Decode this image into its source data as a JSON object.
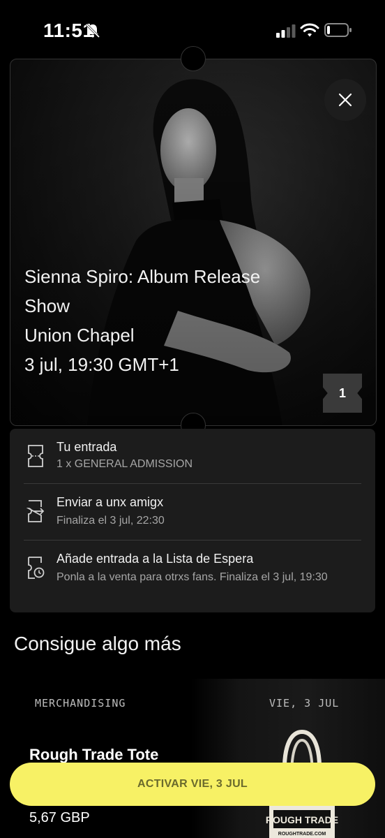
{
  "status_bar": {
    "time": "11:51"
  },
  "event": {
    "title": "Sienna Spiro: Album Release Show",
    "venue": "Union Chapel",
    "date": "3 jul, 19:30 GMT+1",
    "ticket_count": "1"
  },
  "actions": [
    {
      "title": "Tu entrada",
      "subtitle": "1 x GENERAL ADMISSION",
      "icon": "ticket-icon"
    },
    {
      "title": "Enviar a unx amigx",
      "subtitle": "Finaliza el 3 jul, 22:30",
      "icon": "send-ticket-icon"
    },
    {
      "title": "Añade entrada a la Lista de Espera",
      "subtitle": "Ponla a la venta para otrxs fans. Finaliza el 3 jul, 19:30",
      "icon": "waitlist-ticket-icon"
    }
  ],
  "upsell": {
    "section_title": "Consigue algo más",
    "merch": {
      "label": "MERCHANDISING",
      "date": "VIE, 3 JUL",
      "name": "Rough Trade Tote",
      "price": "5,67 GBP",
      "tote_brand": "ROUGH TRADE",
      "tote_url": "ROUGHTRADE.COM"
    }
  },
  "cta": {
    "label": "ACTIVAR VIE, 3 JUL",
    "color": "#f7f165"
  }
}
